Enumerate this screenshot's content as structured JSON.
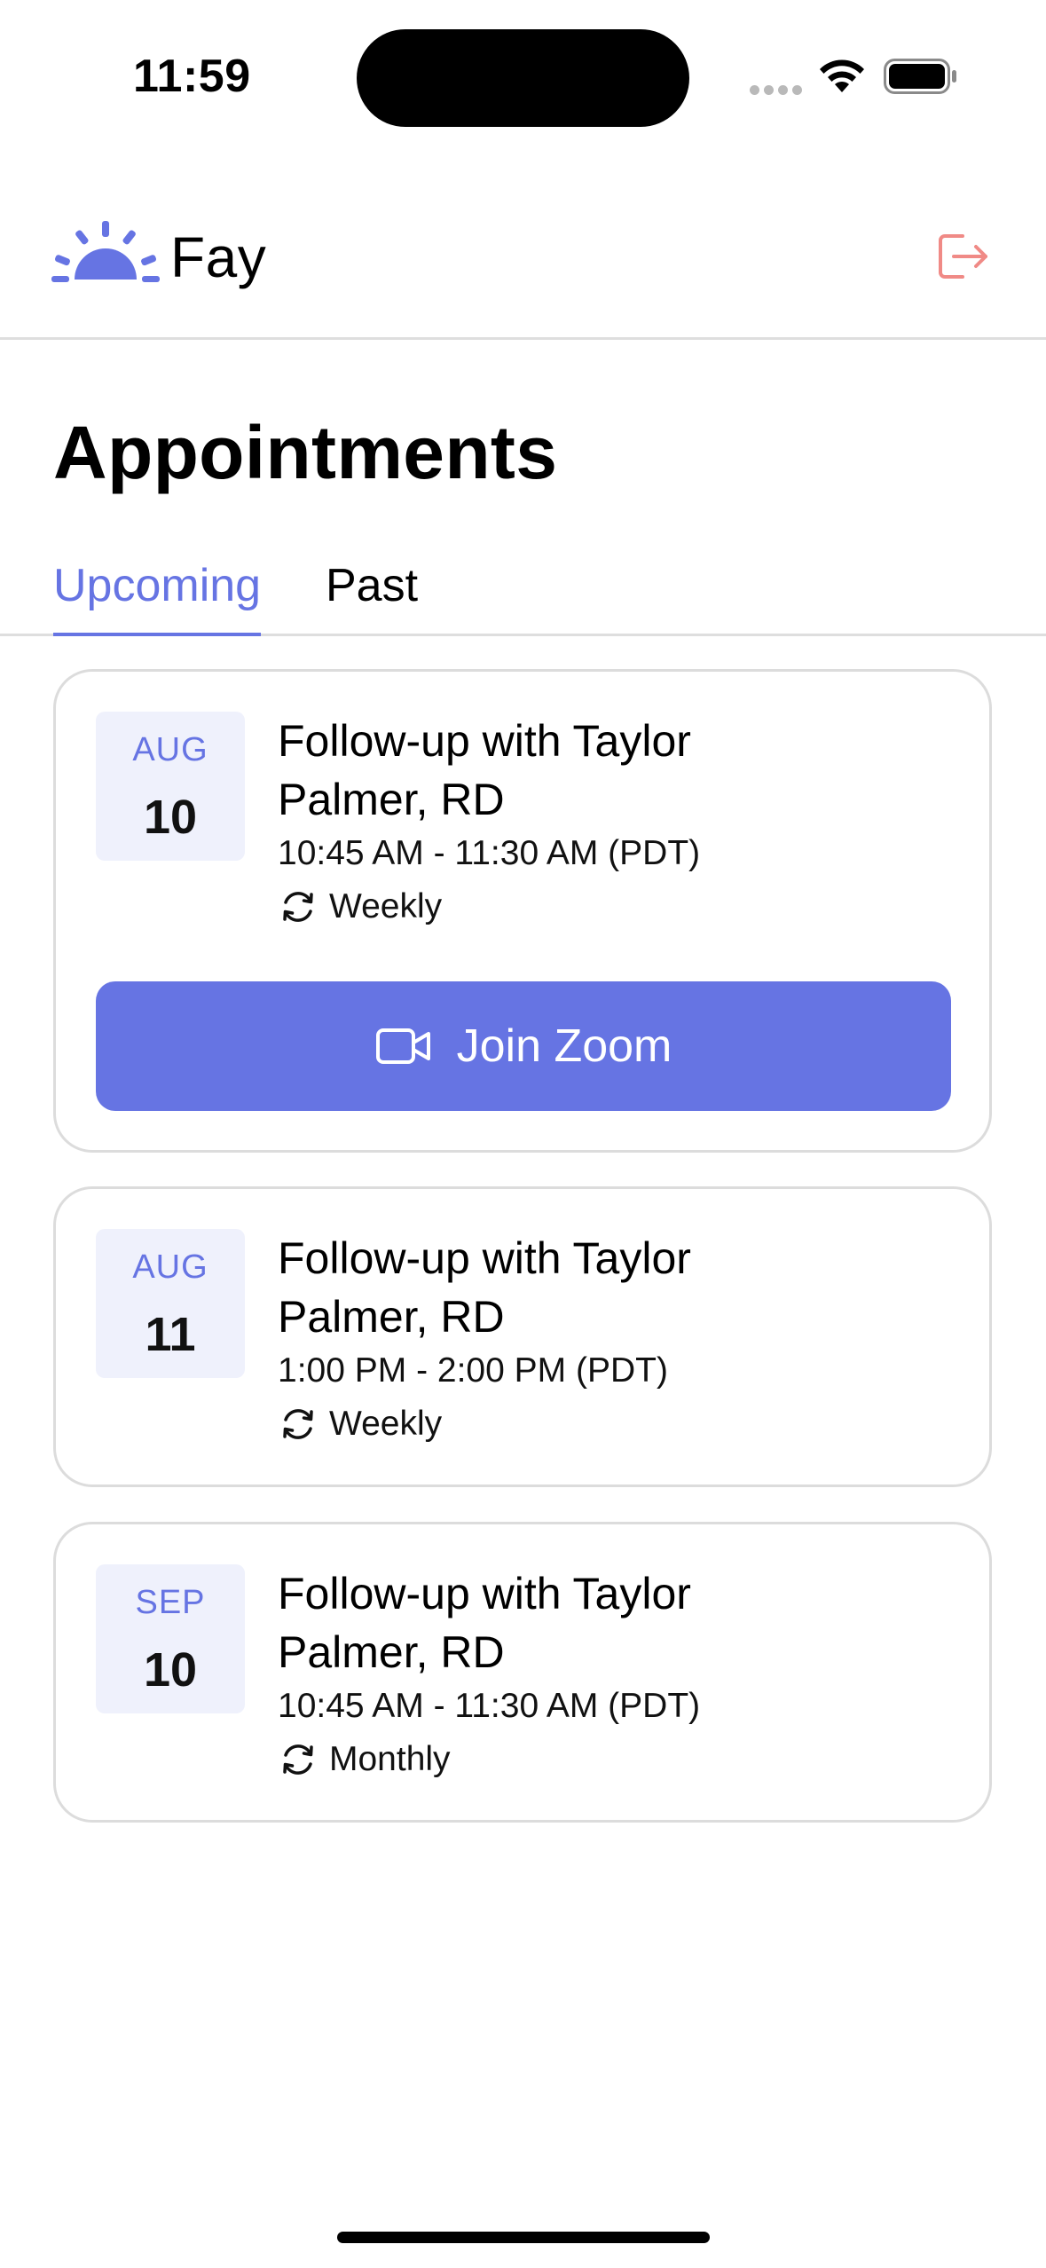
{
  "status_bar": {
    "time": "11:59"
  },
  "header": {
    "app_name": "Fay",
    "brand_color": "#6674e3",
    "logout_icon": "logout-icon",
    "logout_color": "#f08a86"
  },
  "page": {
    "title": "Appointments"
  },
  "tabs": [
    {
      "label": "Upcoming",
      "active": true
    },
    {
      "label": "Past",
      "active": false
    }
  ],
  "appointments": [
    {
      "month": "AUG",
      "day": "10",
      "title": "Follow-up with Taylor Palmer, RD",
      "time": "10:45 AM - 11:30 AM (PDT)",
      "recurrence": "Weekly",
      "join_label": "Join Zoom"
    },
    {
      "month": "AUG",
      "day": "11",
      "title": "Follow-up with Taylor Palmer, RD",
      "time": "1:00 PM - 2:00 PM (PDT)",
      "recurrence": "Weekly"
    },
    {
      "month": "SEP",
      "day": "10",
      "title": "Follow-up with Taylor Palmer, RD",
      "time": "10:45 AM - 11:30 AM (PDT)",
      "recurrence": "Monthly"
    }
  ]
}
